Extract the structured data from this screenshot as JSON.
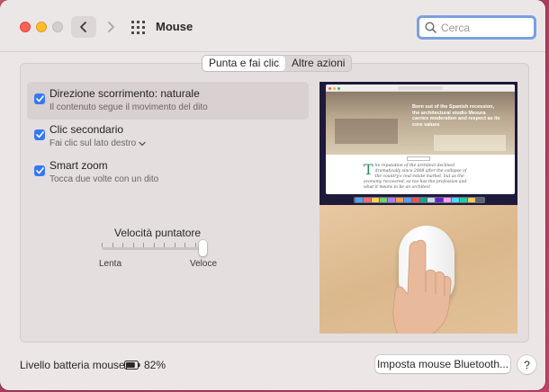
{
  "window": {
    "title": "Mouse"
  },
  "search": {
    "placeholder": "Cerca",
    "value": ""
  },
  "tabs": [
    {
      "label": "Punta e fai clic",
      "active": true
    },
    {
      "label": "Altre azioni",
      "active": false
    }
  ],
  "options": [
    {
      "title": "Direzione scorrimento: naturale",
      "subtitle": "Il contenuto segue il movimento del dito",
      "checked": true
    },
    {
      "title": "Clic secondario",
      "subtitle": "Fai clic sul lato destro",
      "checked": true
    },
    {
      "title": "Smart zoom",
      "subtitle": "Tocca due volte con un dito",
      "checked": true
    }
  ],
  "pointer_speed": {
    "title": "Velocità puntatore",
    "min_label": "Lenta",
    "max_label": "Veloce",
    "value_fraction": 1.0
  },
  "preview": {
    "hero_text": "Born out of the Spanish recession, the architectural studio Mesura carries moderation and respect as its core values",
    "drop_cap": "T",
    "article_text": "he reputation of the architect declined dramatically since 2008 after the collapse of the country's real estate market, but as the economy recovered, so too has the profession and what it means to be an architect"
  },
  "footer": {
    "battery_label": "Livello batteria mouse:",
    "battery_percent": "82%",
    "battery_level": 0.82,
    "bluetooth_button": "Imposta mouse Bluetooth...",
    "help_button": "?"
  },
  "colors": {
    "accent": "#3478f6",
    "search_focus": "#7b9fe0"
  }
}
